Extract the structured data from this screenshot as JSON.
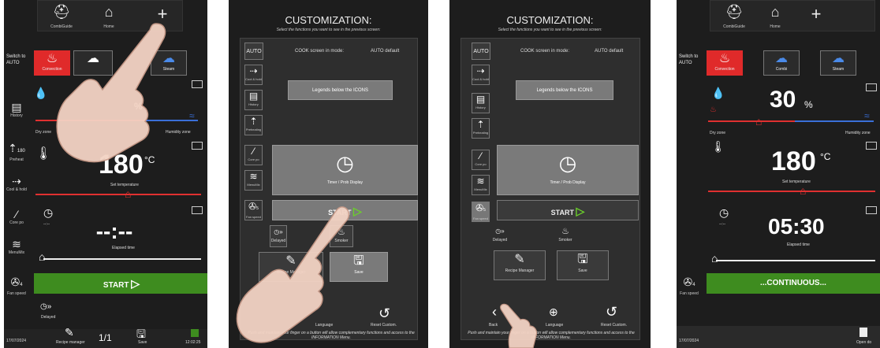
{
  "p1": {
    "header": [
      {
        "icon": "chef-hat-icon",
        "label": "CombiGuide"
      },
      {
        "icon": "home-icon",
        "label": "Home"
      },
      {
        "icon": "plus-icon",
        "label": ""
      }
    ],
    "switch_label": "Switch to AUTO",
    "modes": [
      {
        "label": "Convection",
        "active": true
      },
      {
        "label": "",
        "active": false
      },
      {
        "label": "Steam",
        "active": false
      }
    ],
    "humidity_label_left": "Dry zone",
    "humidity_label_right": "Humidity zone",
    "humidity_partial": "%",
    "temp_value": "180",
    "temp_unit": "°C",
    "temp_label": "Set temperature",
    "time_value": "--:--",
    "time_small": "--:--",
    "time_label": "Elapsed time",
    "side": [
      {
        "label": "History"
      },
      {
        "label": "Preheat"
      },
      {
        "label": "Cool & hold"
      },
      {
        "label": "Core po"
      },
      {
        "label": "MenuMix"
      },
      {
        "label": "Fan speed"
      }
    ],
    "preheat_value": "180",
    "fan_value": "4",
    "start_label": "START",
    "delayed_label": "Delayed",
    "footer": {
      "date": "17/07/2024",
      "recipe": "Recipe manager",
      "page": "1/1",
      "save": "Save",
      "time": "12:02:25"
    }
  },
  "p2": {
    "title": "CUSTOMIZATION:",
    "subtitle": "Select the functions you want to see in the previous screen:",
    "auto_label": "AUTO",
    "cook_mode_label": "COOK screen in mode:",
    "cook_mode_value": "AUTO default",
    "side": [
      {
        "label": "Cool & hold"
      },
      {
        "label": "History"
      },
      {
        "label": "Preheating"
      },
      {
        "label": "Core po"
      },
      {
        "label": "MenuMix"
      },
      {
        "label": "Fan speed"
      }
    ],
    "fan_value": "5",
    "legends_button": "Legends below the ICONS",
    "timer_label": "Timer / Prob Display",
    "start_label": "START",
    "delayed_label": "Delayed",
    "smoker_label": "Smoker",
    "recipe_label": "Recipe Manager",
    "save_label": "Save",
    "language_label": "Language",
    "reset_label": "Reset Custom.",
    "hint": "Push and maintain your finger on a button will allow complementary functions and access to the INFORMATION Menu."
  },
  "p3": {
    "title": "CUSTOMIZATION:",
    "subtitle": "Select the functions you want to see in the previous screen:",
    "auto_label": "AUTO",
    "cook_mode_label": "COOK screen in mode:",
    "cook_mode_value": "AUTO default",
    "side": [
      {
        "label": "Cool & hold"
      },
      {
        "label": "History"
      },
      {
        "label": "Preheating"
      },
      {
        "label": "Core po"
      },
      {
        "label": "MenuMix"
      },
      {
        "label": "Fan speed"
      }
    ],
    "fan_value": "5",
    "legends_button": "Legends below the ICONS",
    "timer_label": "Timer / Prob Display",
    "start_label": "START",
    "delayed_label": "Delayed",
    "smoker_label": "Smoker",
    "recipe_label": "Recipe Manager",
    "save_label": "Save",
    "back_label": "Back",
    "language_label": "Language",
    "reset_label": "Reset Custom.",
    "hint": "Push and maintain your finger on a button will allow complementary functions and access to the INFORMATION Menu."
  },
  "p4": {
    "header": [
      {
        "icon": "chef-hat-icon",
        "label": "CombiGuide"
      },
      {
        "icon": "home-icon",
        "label": "Home"
      },
      {
        "icon": "plus-icon",
        "label": ""
      }
    ],
    "switch_label": "Switch to AUTO",
    "modes": [
      {
        "label": "Convection",
        "active": true
      },
      {
        "label": "Combi",
        "active": false
      },
      {
        "label": "Steam",
        "active": false
      }
    ],
    "humidity_value": "30",
    "humidity_unit": "%",
    "humidity_label_left": "Dry zone",
    "humidity_label_right": "Humidity zone",
    "temp_value": "180",
    "temp_unit": "°C",
    "temp_label": "Set temperature",
    "time_value": "05:30",
    "time_small": "--:--",
    "time_label": "Elapsed time",
    "fan_value": "4",
    "fan_label": "Fan speed",
    "continuous_label": "...CONTINUOUS...",
    "footer": {
      "date": "17/07/2024",
      "open": "Open do"
    }
  }
}
